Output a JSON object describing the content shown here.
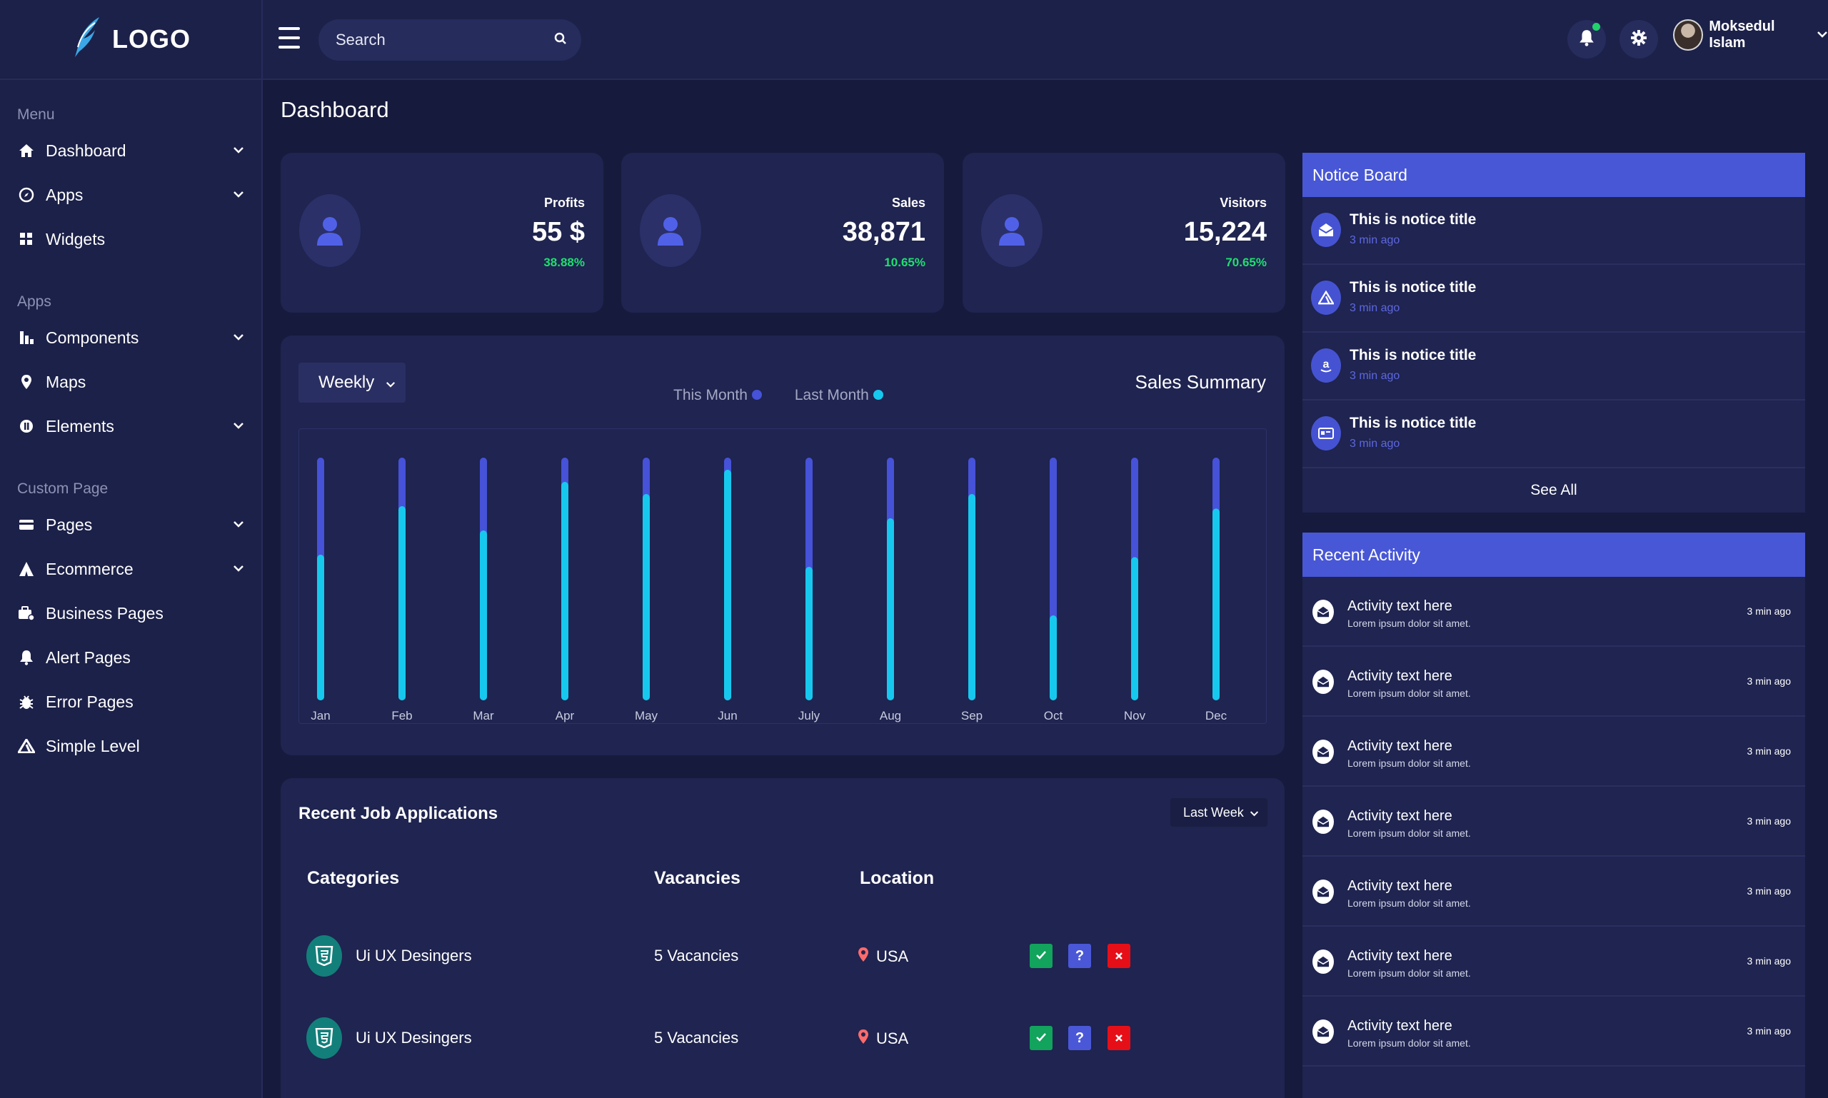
{
  "brand": {
    "logo_text": "LOGO",
    "accent": "#4857d6",
    "bg": "#161a3c",
    "card": "#1f2450"
  },
  "topbar": {
    "search_placeholder": "Search",
    "user_name": "Moksedul Islam",
    "icons": [
      "menu-icon",
      "search-icon",
      "bell-icon",
      "gear-icon",
      "chevron-down-icon"
    ]
  },
  "sidebar": {
    "sections": [
      {
        "label": "Menu",
        "items": [
          {
            "label": "Dashboard",
            "icon": "home-icon",
            "expandable": true
          },
          {
            "label": "Apps",
            "icon": "compass-icon",
            "expandable": true
          },
          {
            "label": "Widgets",
            "icon": "grid-icon",
            "expandable": false
          }
        ]
      },
      {
        "label": "Apps",
        "items": [
          {
            "label": "Components",
            "icon": "chart-icon",
            "expandable": true
          },
          {
            "label": "Maps",
            "icon": "pin-icon",
            "expandable": false
          },
          {
            "label": "Elements",
            "icon": "circle-icon",
            "expandable": true
          }
        ]
      },
      {
        "label": "Custom Page",
        "items": [
          {
            "label": "Pages",
            "icon": "card-icon",
            "expandable": true
          },
          {
            "label": "Ecommerce",
            "icon": "tent-icon",
            "expandable": true
          },
          {
            "label": "Business Pages",
            "icon": "briefcase-icon",
            "expandable": false
          },
          {
            "label": "Alert Pages",
            "icon": "bell-icon",
            "expandable": false
          },
          {
            "label": "Error Pages",
            "icon": "bug-icon",
            "expandable": false
          },
          {
            "label": "Simple Level",
            "icon": "triangle-icon",
            "expandable": false
          }
        ]
      }
    ]
  },
  "main": {
    "title": "Dashboard",
    "stats": [
      {
        "label": "Profits",
        "value": "55 $",
        "change": "38.88%"
      },
      {
        "label": "Sales",
        "value": "38,871",
        "change": "10.65%"
      },
      {
        "label": "Visitors",
        "value": "15,224",
        "change": "70.65%"
      }
    ],
    "sales_summary": {
      "title": "Sales Summary",
      "period": "Weekly",
      "legend": [
        {
          "name": "This Month",
          "color": "#4652d8"
        },
        {
          "name": "Last Month",
          "color": "#17c8ee"
        }
      ]
    },
    "jobs": {
      "title": "Recent Job Applications",
      "filter": "Last Week",
      "headers": [
        "Categories",
        "Vacancies",
        "Location"
      ],
      "rows": [
        {
          "category": "Ui UX Desingers",
          "vacancies": "5 Vacancies",
          "location": "USA",
          "actions": [
            "?"
          ]
        },
        {
          "category": "Ui UX Desingers",
          "vacancies": "5 Vacancies",
          "location": "USA",
          "actions": [
            "?"
          ]
        }
      ]
    }
  },
  "notice_board": {
    "title": "Notice Board",
    "see_all": "See All",
    "items": [
      {
        "title": "This is notice title",
        "time": "3 min ago",
        "icon": "envelope-open-icon"
      },
      {
        "title": "This is notice title",
        "time": "3 min ago",
        "icon": "triangle-logo-icon"
      },
      {
        "title": "This is notice title",
        "time": "3 min ago",
        "icon": "amazon-icon"
      },
      {
        "title": "This is notice title",
        "time": "3 min ago",
        "icon": "credit-card-icon"
      }
    ]
  },
  "recent_activity": {
    "title": "Recent Activity",
    "items": [
      {
        "title": "Activity text here",
        "sub": "Lorem ipsum dolor sit amet.",
        "time": "3 min ago"
      },
      {
        "title": "Activity text here",
        "sub": "Lorem ipsum dolor sit amet.",
        "time": "3 min ago"
      },
      {
        "title": "Activity text here",
        "sub": "Lorem ipsum dolor sit amet.",
        "time": "3 min ago"
      },
      {
        "title": "Activity text here",
        "sub": "Lorem ipsum dolor sit amet.",
        "time": "3 min ago"
      },
      {
        "title": "Activity text here",
        "sub": "Lorem ipsum dolor sit amet.",
        "time": "3 min ago"
      },
      {
        "title": "Activity text here",
        "sub": "Lorem ipsum dolor sit amet.",
        "time": "3 min ago"
      },
      {
        "title": "Activity text here",
        "sub": "Lorem ipsum dolor sit amet.",
        "time": "3 min ago"
      }
    ]
  },
  "chart_data": {
    "type": "bar",
    "categories": [
      "Jan",
      "Feb",
      "Mar",
      "Apr",
      "May",
      "Jun",
      "July",
      "Aug",
      "Sep",
      "Oct",
      "Nov",
      "Dec"
    ],
    "series": [
      {
        "name": "This Month",
        "values": [
          100,
          100,
          100,
          100,
          100,
          100,
          100,
          100,
          100,
          100,
          100,
          100
        ]
      },
      {
        "name": "Last Month",
        "values": [
          60,
          80,
          70,
          90,
          85,
          95,
          55,
          75,
          85,
          35,
          59,
          79
        ]
      }
    ],
    "title": "Sales Summary",
    "ylim": [
      0,
      100
    ],
    "grid": false,
    "legend": "top-center"
  }
}
